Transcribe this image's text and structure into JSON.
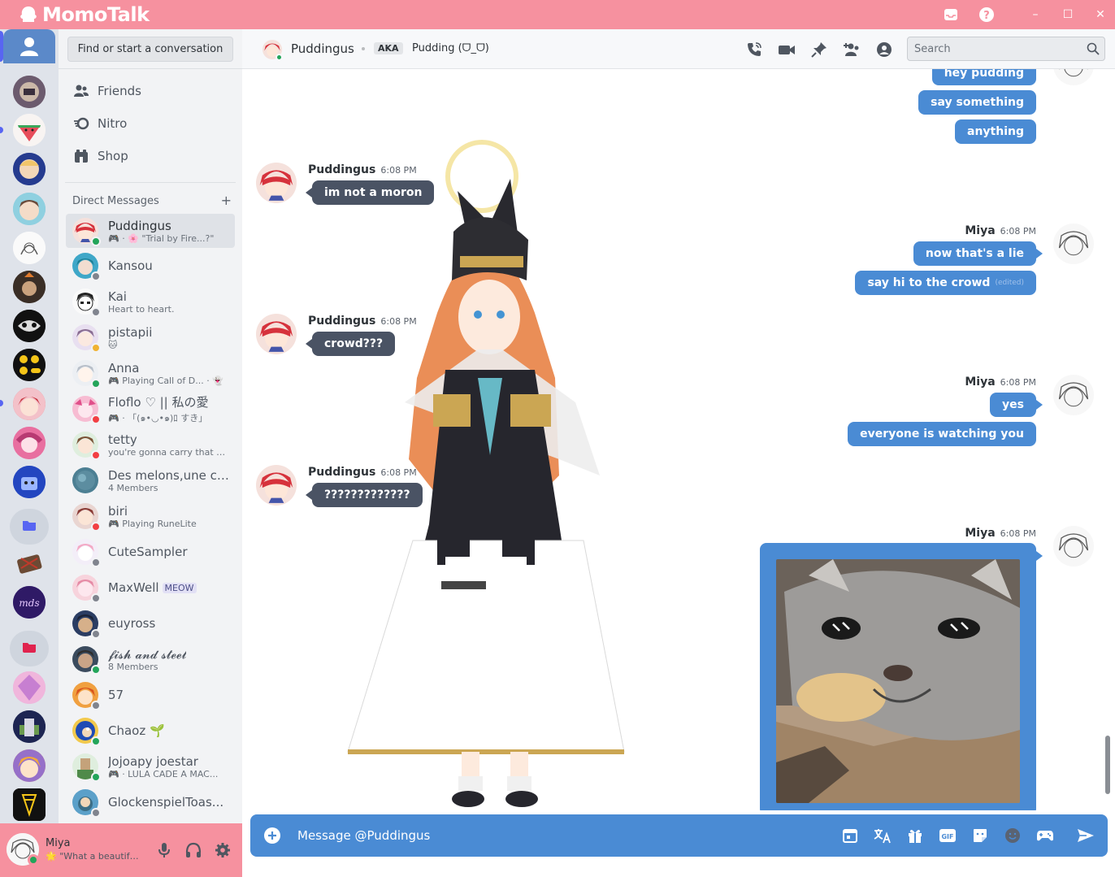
{
  "app": {
    "title": "MomoTalk"
  },
  "titlebar": {
    "minimize": "–",
    "maximize": "☐",
    "close": "✕"
  },
  "dm_panel": {
    "find_button": "Find or start a conversation",
    "nav": [
      {
        "label": "Friends",
        "icon": "friends-icon"
      },
      {
        "label": "Nitro",
        "icon": "nitro-icon"
      },
      {
        "label": "Shop",
        "icon": "shop-icon"
      }
    ],
    "section_title": "Direct Messages",
    "add_dm": "+",
    "dms": [
      {
        "name": "Puddingus",
        "sub": "🎮 · 🌸 \"Trial by Fire...?\"",
        "status": "online",
        "active": true
      },
      {
        "name": "Kansou",
        "sub": "",
        "status": "offline"
      },
      {
        "name": "Kai",
        "sub": "Heart to heart.",
        "status": "offline"
      },
      {
        "name": "pistapii",
        "sub": "🐱",
        "status": "idle"
      },
      {
        "name": "Anna",
        "sub": "🎮 Playing Call of D... · 👻",
        "status": "online"
      },
      {
        "name": "Floflo ♡ || 私の愛",
        "sub": "🎮 · 「(๑•◡•๑)ﾛ すき」",
        "status": "dnd"
      },
      {
        "name": "tetty",
        "sub": "you're gonna carry that w...",
        "status": "dnd"
      },
      {
        "name": "Des melons,une ci...",
        "sub": "4 Members",
        "status": "none"
      },
      {
        "name": "biri",
        "sub": "🎮 Playing RuneLite",
        "status": "dnd"
      },
      {
        "name": "CuteSampler",
        "sub": "",
        "status": "offline"
      },
      {
        "name": "MaxWell",
        "sub": "",
        "badge": "MEOW",
        "status": "offline"
      },
      {
        "name": "euyross",
        "sub": "",
        "status": "offline"
      },
      {
        "name": "𝓯𝓲𝓼𝓱 𝓪𝓷𝓭 𝓼𝓽𝓮𝓮𝓵",
        "sub": "8 Members",
        "status": "online"
      },
      {
        "name": "57",
        "sub": "",
        "status": "offline"
      },
      {
        "name": "Chaoz 🌱",
        "sub": "",
        "status": "online"
      },
      {
        "name": "Jojoapy joestar",
        "sub": "🎮 · LULA CADE A MAC...",
        "status": "online"
      },
      {
        "name": "GlockenspielToas...",
        "sub": "",
        "status": "offline"
      }
    ]
  },
  "user_panel": {
    "name": "Miya",
    "status_text": "🌟 \"What a beautiful ...",
    "status": "online"
  },
  "chat_header": {
    "name": "Puddingus",
    "aka_label": "AKA",
    "nickname": "Pudding (ᗜ_ᗜ)",
    "search_placeholder": "Search"
  },
  "messages": [
    {
      "author": "Miya",
      "side": "right",
      "time": "",
      "lines": [
        "hey pudding",
        "say something",
        "anything"
      ]
    },
    {
      "author": "Puddingus",
      "side": "left",
      "time": "6:08 PM",
      "lines": [
        "im not a moron"
      ]
    },
    {
      "author": "Miya",
      "side": "right",
      "time": "6:08 PM",
      "lines": [
        "now that's a lie",
        "say hi to the crowd"
      ],
      "edited": "(edited)"
    },
    {
      "author": "Puddingus",
      "side": "left",
      "time": "6:08 PM",
      "lines": [
        "crowd???"
      ]
    },
    {
      "author": "Miya",
      "side": "right",
      "time": "6:08 PM",
      "lines": [
        "yes",
        "everyone is watching you"
      ]
    },
    {
      "author": "Puddingus",
      "side": "left",
      "time": "6:08 PM",
      "lines": [
        "?????????????"
      ]
    },
    {
      "author": "Miya",
      "side": "right",
      "time": "6:08 PM",
      "attachment": "cat-image"
    }
  ],
  "composer": {
    "placeholder": "Message @Puddingus",
    "gif_label": "GIF"
  },
  "colors": {
    "accent_pink": "#f6919f",
    "bubble_blue": "#4a8bd4",
    "bubble_dark": "#4a5364",
    "online": "#23a55a",
    "dnd": "#f23f43",
    "idle": "#f0b232",
    "offline": "#80848e"
  }
}
